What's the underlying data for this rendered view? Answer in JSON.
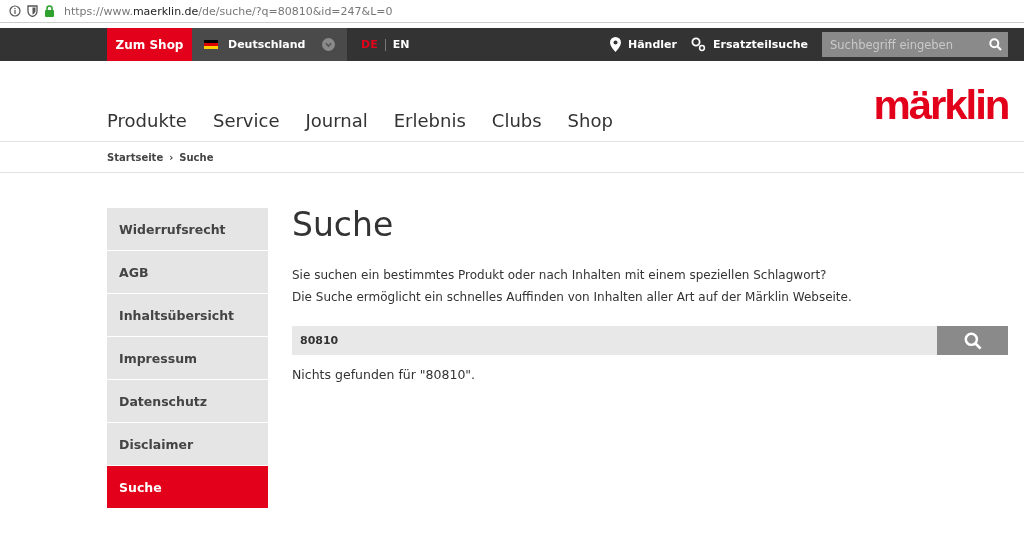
{
  "address_bar": {
    "url_prefix": "https://www.",
    "url_domain": "maerklin.de",
    "url_path": "/de/suche/?q=80810&id=247&L=0"
  },
  "top_bar": {
    "shop_button": "Zum Shop",
    "country": "Deutschland",
    "languages": [
      {
        "label": "DE",
        "selected": true
      },
      {
        "label": "EN",
        "selected": false
      }
    ],
    "dealer_link": "Händler",
    "parts_link": "Ersatzteilsuche",
    "search": {
      "placeholder": "Suchbegriff eingeben"
    }
  },
  "nav": {
    "items": [
      "Produkte",
      "Service",
      "Journal",
      "Erlebnis",
      "Clubs",
      "Shop"
    ],
    "logo": "märklin"
  },
  "breadcrumb": {
    "items": [
      "Startseite",
      "Suche"
    ],
    "separator": "›"
  },
  "sidebar": {
    "items": [
      {
        "label": "Widerrufsrecht",
        "selected": false
      },
      {
        "label": "AGB",
        "selected": false
      },
      {
        "label": "Inhaltsübersicht",
        "selected": false
      },
      {
        "label": "Impressum",
        "selected": false
      },
      {
        "label": "Datenschutz",
        "selected": false
      },
      {
        "label": "Disclaimer",
        "selected": false
      },
      {
        "label": "Suche",
        "selected": true
      }
    ]
  },
  "main": {
    "heading": "Suche",
    "intro": [
      "Sie suchen ein bestimmtes Produkt oder nach Inhalten mit einem speziellen Schlagwort?",
      "Die Suche ermöglicht ein schnelles Auffinden von Inhalten aller Art auf der Märklin Webseite."
    ],
    "search": {
      "value": "80810"
    },
    "result": "Nichts gefunden für \"80810\"."
  }
}
